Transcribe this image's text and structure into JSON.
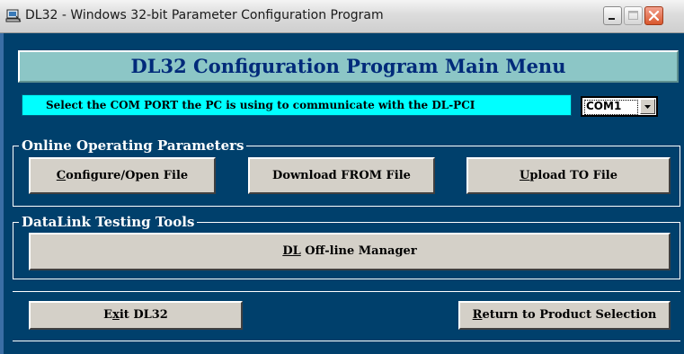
{
  "window": {
    "title": "DL32 - Windows 32-bit Parameter Configuration Program"
  },
  "main": {
    "banner": "DL32 Configuration Program Main Menu",
    "com_label": "Select the COM PORT the PC is using to communicate with the DL-PCI",
    "com_port": {
      "selected": "COM1"
    }
  },
  "groups": {
    "online": {
      "legend": "Online Operating Parameters",
      "buttons": [
        {
          "mnemonic": "C",
          "rest": "onfigure/Open File"
        },
        {
          "mnemonic": "",
          "rest": "Download FROM File"
        },
        {
          "mnemonic": "U",
          "rest": "pload TO File"
        }
      ]
    },
    "testing": {
      "legend": "DataLink Testing Tools",
      "button": {
        "mnemonic": "DL",
        "rest": " Off-line Manager"
      }
    }
  },
  "footer": {
    "exit": {
      "pre": "E",
      "mnemonic": "x",
      "rest": "it DL32"
    },
    "return": {
      "mnemonic": "R",
      "rest": "eturn to Product Selection"
    }
  },
  "icons": {
    "app": "computer-icon",
    "minimize": "minimize-icon",
    "maximize": "maximize-icon",
    "close": "close-icon",
    "dropdown": "chevron-down-icon"
  },
  "colors": {
    "client_background": "#00406c",
    "banner_background": "#8cc6c6",
    "banner_text": "#002a7a",
    "com_label_background": "#00ffff",
    "button_face": "#d4d0c8",
    "close_button": "#d9572d"
  }
}
